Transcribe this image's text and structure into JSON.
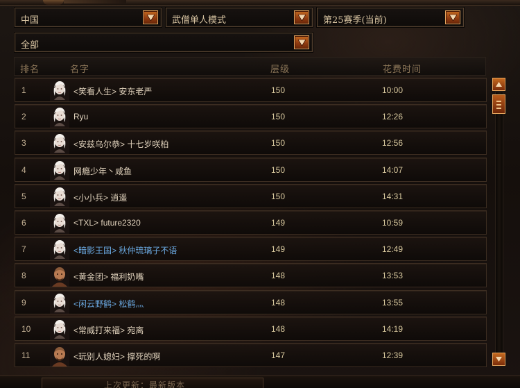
{
  "filters": {
    "region": "中国",
    "mode": "武僧单人模式",
    "season": "第25赛季(当前)",
    "scope": "全部"
  },
  "columns": {
    "rank": "排名",
    "name": "名字",
    "level": "层级",
    "time": "花费时间"
  },
  "rows": [
    {
      "rank": "1",
      "name": "<笑看人生> 安东老严",
      "level": "150",
      "time": "10:00",
      "portrait": "female-monk-portrait",
      "highlight": false
    },
    {
      "rank": "2",
      "name": "Ryu",
      "level": "150",
      "time": "12:26",
      "portrait": "female-monk-portrait",
      "highlight": false
    },
    {
      "rank": "3",
      "name": "<安兹乌尔恭> 十七岁咲柏",
      "level": "150",
      "time": "12:56",
      "portrait": "female-monk-portrait",
      "highlight": false
    },
    {
      "rank": "4",
      "name": "网瘾少年丶咸鱼",
      "level": "150",
      "time": "14:07",
      "portrait": "female-monk-portrait",
      "highlight": false
    },
    {
      "rank": "5",
      "name": "<小小兵> 逍遥",
      "level": "150",
      "time": "14:31",
      "portrait": "female-monk-portrait",
      "highlight": false
    },
    {
      "rank": "6",
      "name": "<TXL> future2320",
      "level": "149",
      "time": "10:59",
      "portrait": "female-monk-portrait",
      "highlight": false
    },
    {
      "rank": "7",
      "name": "<暗影王国> 秋仲琉璃子不语",
      "level": "149",
      "time": "12:49",
      "portrait": "female-monk-portrait",
      "highlight": true
    },
    {
      "rank": "8",
      "name": "<黄金团> 福利奶嘴",
      "level": "148",
      "time": "13:53",
      "portrait": "male-monk-portrait",
      "highlight": false
    },
    {
      "rank": "9",
      "name": "<闲云野鹤> 松鹤灬",
      "level": "148",
      "time": "13:55",
      "portrait": "female-monk-portrait",
      "highlight": true
    },
    {
      "rank": "10",
      "name": "<常威打来福> 宛离",
      "level": "148",
      "time": "14:19",
      "portrait": "female-monk-portrait",
      "highlight": false
    },
    {
      "rank": "11",
      "name": "<玩别人媳妇> 撑死的啊",
      "level": "147",
      "time": "12:39",
      "portrait": "male-monk-portrait",
      "highlight": false
    }
  ],
  "bottom": {
    "label": "上次更新：最新版本"
  },
  "colors": {
    "accent_orange": "#c56a20",
    "clan_blue": "#6aa8e0",
    "text_light": "#e0d2bc",
    "text_gold": "#d8c89e"
  }
}
